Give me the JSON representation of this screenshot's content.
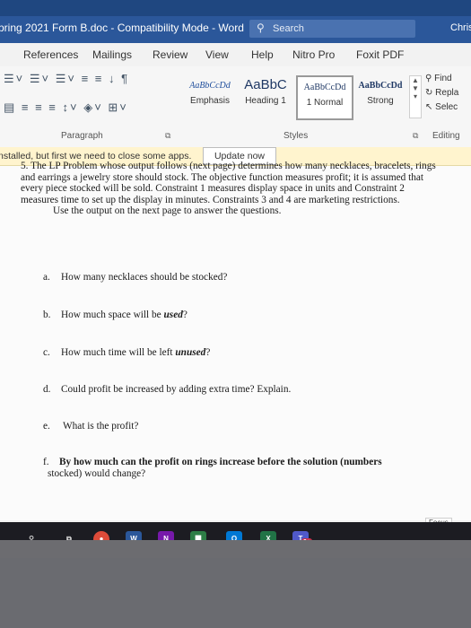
{
  "titlebar": {
    "doc_title": "pring 2021 Form B.doc  -  Compatibility Mode  -  Word",
    "search_label": "Search",
    "user": "Chris"
  },
  "tabs": [
    "References",
    "Mailings",
    "Review",
    "View",
    "Help",
    "Nitro Pro",
    "Foxit PDF"
  ],
  "ribbon": {
    "styles": [
      {
        "preview": "AaBbCcDd",
        "name": "Emphasis"
      },
      {
        "preview": "AaBbC",
        "name": "Heading 1"
      },
      {
        "preview": "AaBbCcDd",
        "name": "1 Normal"
      },
      {
        "preview": "AaBbCcDd",
        "name": "Strong"
      }
    ],
    "paragraph_label": "Paragraph",
    "styles_label": "Styles",
    "editing_label": "Editing",
    "find": "Find",
    "replace": "Repla",
    "select": "Selec"
  },
  "notice": {
    "message": "nstalled, but first we need to close some apps.",
    "button": "Update now"
  },
  "document": {
    "intro": "5. The LP Problem whose output follows (next page) determines how many necklaces, bracelets, rings and earrings a jewelry store should stock. The objective function measures profit; it is assumed that every piece stocked will be sold. Constraint 1 measures display space in units and Constraint 2 measures time to set up the display in minutes. Constraints 3 and 4 are marketing restrictions.",
    "instruction": "Use the output on the next page to answer the questions.",
    "questions": [
      {
        "label": "a.",
        "text": "How many necklaces should be stocked?"
      },
      {
        "label": "b.",
        "text": "How much space will be",
        "emph": "used",
        "after": "?"
      },
      {
        "label": "c.",
        "text": "How much time will be left",
        "emph": "unused",
        "after": "?"
      },
      {
        "label": "d.",
        "text": "Could profit be increased by adding extra time? Explain."
      },
      {
        "label": "e.",
        "text": "What is the profit?"
      },
      {
        "label": "f.",
        "text_line1": "By how much can the profit on rings increase before the solution (numbers",
        "text_line2": "stocked) would change?"
      }
    ],
    "focus": "Focus"
  },
  "taskbar": {
    "icons": [
      "pin-icon",
      "task-view-icon",
      "chrome-icon",
      "word-icon",
      "onenote-icon",
      "files-icon",
      "outlook-icon",
      "excel-icon",
      "teams-icon"
    ],
    "teams_badge": "9+"
  }
}
